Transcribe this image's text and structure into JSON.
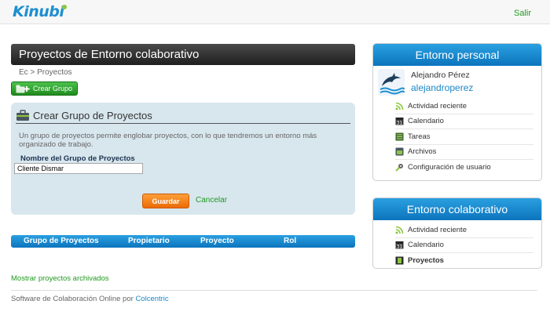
{
  "header": {
    "logo_text": "Kinubi",
    "logout_label": "Salir"
  },
  "page": {
    "title": "Proyectos de Entorno colaborativo",
    "breadcrumb": "Ec > Proyectos",
    "create_group_button": "Crear Grupo"
  },
  "create_form": {
    "title": "Crear Grupo de Proyectos",
    "description": "Un grupo de proyectos permite englobar proyectos, con lo que tendremos un entorno más organizado de trabajo.",
    "field_label": "Nombre del Grupo de Proyectos",
    "field_value": "Cliente Dismar",
    "save_label": "Guardar",
    "cancel_label": "Cancelar"
  },
  "table": {
    "columns": [
      "Grupo de Proyectos",
      "Propietario",
      "Proyecto",
      "Rol"
    ]
  },
  "archived_link": "Mostrar proyectos archivados",
  "footer": {
    "text": "Software de Colaboración Online por ",
    "link": "Colcentric"
  },
  "personal_panel": {
    "title": "Entorno personal",
    "user_name": "Alejandro Pérez",
    "username": "alejandroperez",
    "items": [
      {
        "label": "Actividad reciente",
        "icon": "rss-icon"
      },
      {
        "label": "Calendario",
        "icon": "calendar-icon"
      },
      {
        "label": "Tareas",
        "icon": "tasks-icon"
      },
      {
        "label": "Archivos",
        "icon": "files-icon"
      },
      {
        "label": "Configuración de usuario",
        "icon": "settings-icon"
      }
    ]
  },
  "collab_panel": {
    "title": "Entorno colaborativo",
    "items": [
      {
        "label": "Actividad reciente",
        "icon": "rss-icon"
      },
      {
        "label": "Calendario",
        "icon": "calendar-icon"
      },
      {
        "label": "Proyectos",
        "icon": "projects-icon",
        "active": true
      }
    ]
  },
  "colors": {
    "brand_blue": "#1d8fd0",
    "green": "#1f9a1f",
    "orange": "#f47b16",
    "panel_bg": "#d8e6ee"
  }
}
